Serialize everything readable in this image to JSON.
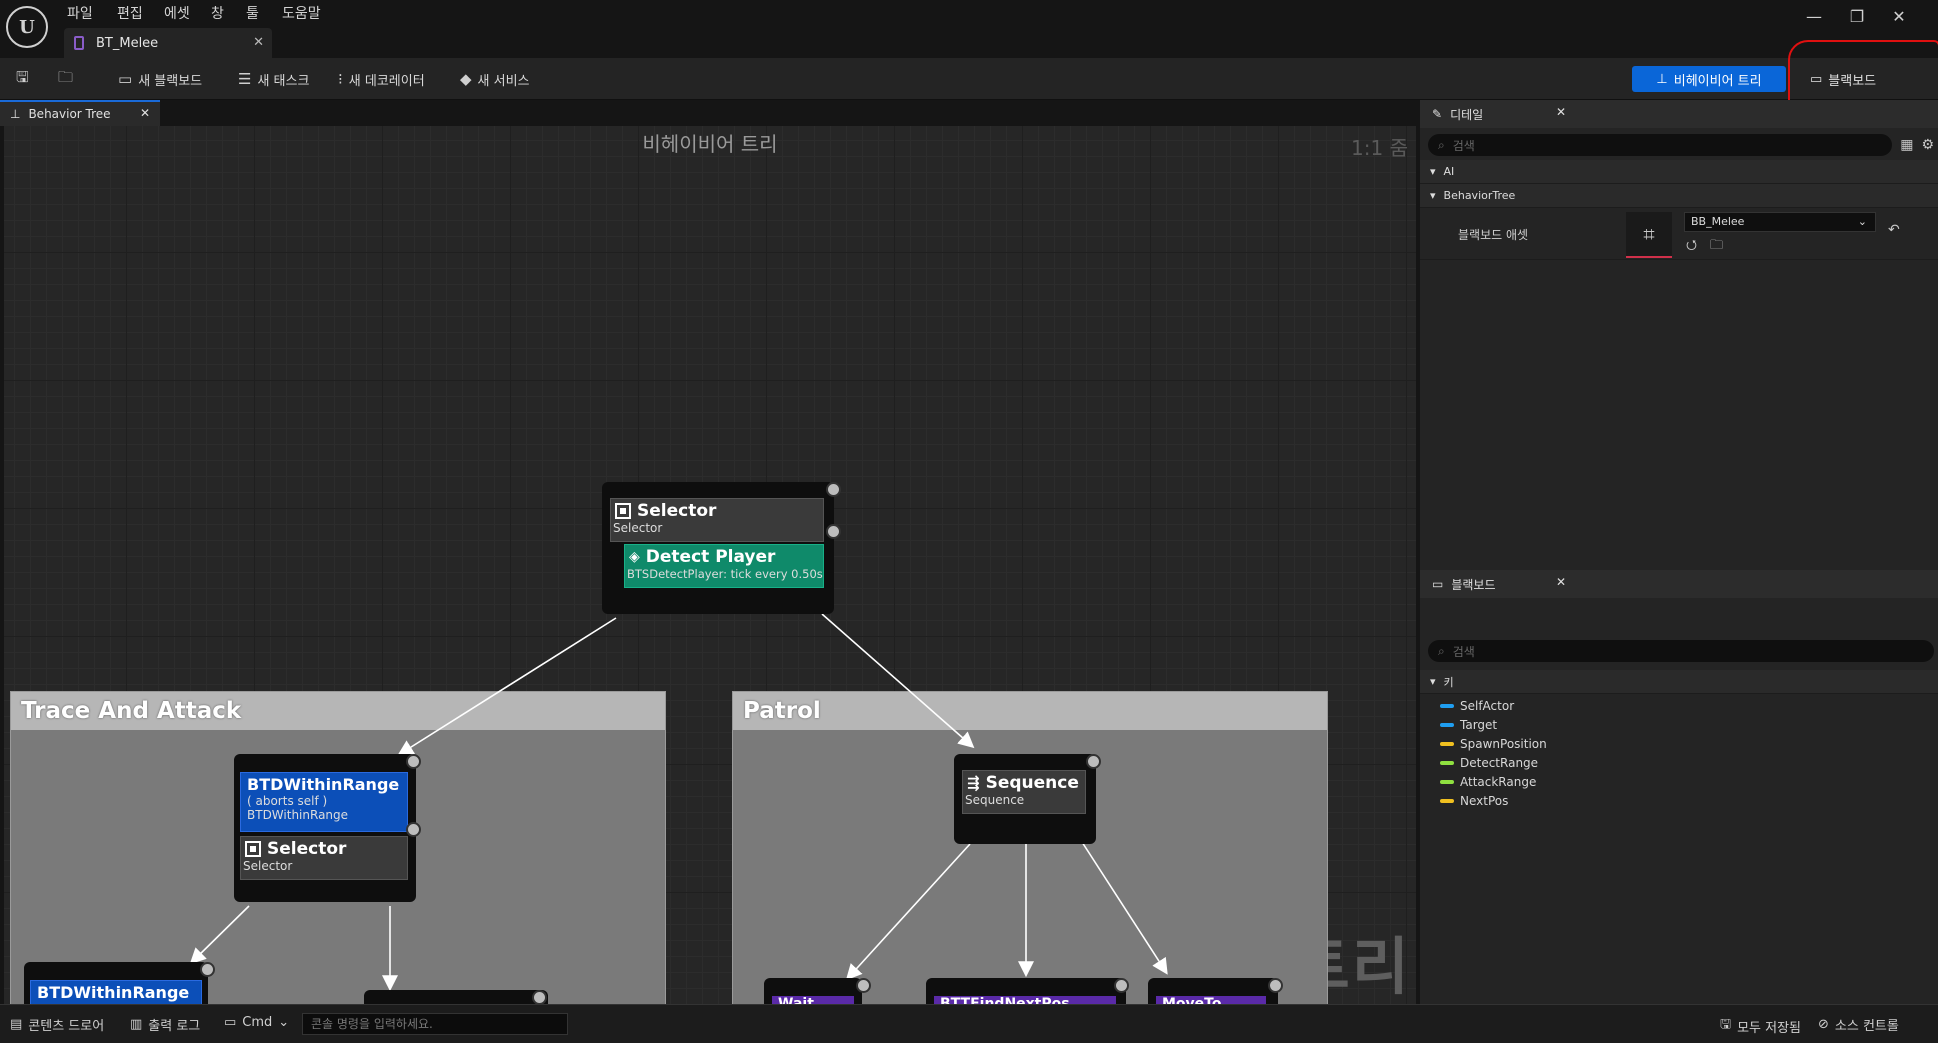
{
  "menu": [
    "파일",
    "편집",
    "에셋",
    "창",
    "툴",
    "도움말"
  ],
  "document_tab": "BT_Melee",
  "toolbar": {
    "new_blackboard": "새 블랙보드",
    "new_task": "새 태스크",
    "new_decorator": "새 데코레이터",
    "new_service": "새 서비스",
    "mode_behavior_tree": "비헤이비어 트리",
    "mode_blackboard": "블랙보드"
  },
  "graph": {
    "tab_label": "Behavior Tree",
    "title": "비헤이비어 트리",
    "zoom": "1:1 줌",
    "watermark": "비헤이비어 트리",
    "root_selector": {
      "title": "Selector",
      "subtitle": "Selector"
    },
    "detect_service": {
      "title": "Detect Player",
      "subtitle": "BTSDetectPlayer: tick every 0.50s"
    },
    "comment_trace": "Trace And Attack",
    "comment_patrol": "Patrol",
    "within_range": {
      "title": "BTDWithinRange",
      "line1": "( aborts self )",
      "line2": "BTDWithinRange"
    },
    "inner_selector": {
      "title": "Selector",
      "subtitle": "Selector"
    },
    "sequence": {
      "title": "Sequence",
      "subtitle": "Sequence"
    },
    "within_range_2": "BTDWithinRange",
    "leaf_wait": "Wait",
    "leaf_find": "BTTFindNextPos",
    "leaf_move": "MoveTo"
  },
  "details": {
    "tab": "디테일",
    "search_placeholder": "검색",
    "cat_ai": "AI",
    "cat_bt": "BehaviorTree",
    "prop_label": "블랙보드 애셋",
    "prop_value": "BB_Melee"
  },
  "blackboard": {
    "tab": "블랙보드",
    "search_placeholder": "검색",
    "keys_header": "키",
    "keys": [
      {
        "name": "SelfActor",
        "color": "#1f9ef0"
      },
      {
        "name": "Target",
        "color": "#1f9ef0"
      },
      {
        "name": "SpawnPosition",
        "color": "#f0c020"
      },
      {
        "name": "DetectRange",
        "color": "#8fe040"
      },
      {
        "name": "AttackRange",
        "color": "#8fe040"
      },
      {
        "name": "NextPos",
        "color": "#f0c020"
      }
    ]
  },
  "status": {
    "content_drawer": "콘텐츠 드로어",
    "output_log": "출력 로그",
    "cmd": "Cmd",
    "cmd_placeholder": "콘솔 명령을 입력하세요.",
    "save_all": "모두 저장됨",
    "source_control": "소스 컨트롤"
  }
}
